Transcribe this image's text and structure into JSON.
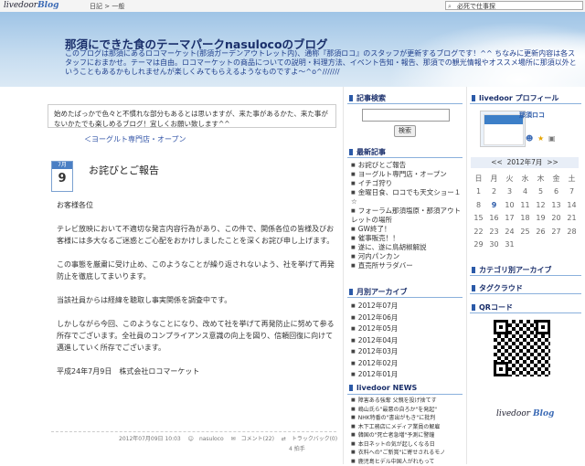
{
  "topbar": {
    "logo": "livedoor",
    "logo_blog": "Blog",
    "crumb": "日記 > 一般",
    "search_value": "必死で仕事探"
  },
  "header": {
    "title": "那須にできた食のテーマパークnasulocoのブログ",
    "description": "このブログは那須にあるロコマーケット(那須ガーデンアウトレット内)、通称『那須ロコ』のスタッフが更新するブログです！^^ ちなみに更新内容は各スタッフにおまかせ。テーマは自由。ロコマーケットの商品についての説明・料理方法、イベント告知・報告、那須での観光情報やオススメ場所に那須以外ということもあるかもしれませんが楽しくみてもらえるようなものですよ～^o^///////"
  },
  "intro": "始めたばっかで色々と不慣れな部分もあるとは思いますが、来た事があるかた、来た事がないかたでも楽しめるブログ！宜しくお願い致します^^",
  "prev_link": "＜ヨーグルト専門店・オープン",
  "post": {
    "month": "7月",
    "day": "9",
    "title": "お詫びとご報告",
    "paragraphs": [
      "お客様各位",
      "テレビ放映において不適切な発言内容行為があり、この件で、関係各位の皆様及びお客様には多大なるご迷惑とご心配をおかけしましたことを深くお詫び申し上げます。",
      "この事態を厳粛に受け止め、このようなことが繰り返されないよう、社を挙げて再発防止を徹底してまいります。",
      "当該社員からは経緯を聴取し事実関係を調査中です。",
      "しかしながら今回、このようなことになり、改めて社を挙げて再発防止に努めて参る所存でございます。全社員のコンプライアンス意識の向上を図り、信頼回復に向けて邁進していく所存でございます。",
      "平成24年7月9日　株式会社ロコマーケット"
    ],
    "meta_date": "2012年07月09日 10:03",
    "meta_author": "nasuloco",
    "meta_comments": "コメント(22)",
    "meta_trackback": "トラックバック(0)",
    "meta_count": "4 拍手"
  },
  "sidebar_mid": {
    "search_heading": "記事検索",
    "search_button": "検索",
    "recent_heading": "最新記事",
    "recent": [
      "お詫びとご報告",
      "ヨーグルト専門店・オープン",
      "イチゴ狩り",
      "金曜日食、ロコでも天文ショー１☆",
      "フォーラム那須塩原・那須アウトレットの場所",
      "GW終了！",
      "催事販売！！",
      "遂に、遂に鳥胡椒解説",
      "河内パンカン",
      "直売所サラダバー"
    ],
    "archive_heading": "月別アーカイブ",
    "archives": [
      "2012年07月",
      "2012年06月",
      "2012年05月",
      "2012年04月",
      "2012年03月",
      "2012年02月",
      "2012年01月"
    ],
    "news_heading": "livedoor NEWS",
    "news": [
      "障害ある強奪 父親を投げ捨てす",
      "嶋山氏ら\"最悪の自ろか\"を発起\"",
      "NHK特番の\"書出がもき\"に批判",
      "木下工務店にメディア業員の解雇",
      "韓国の\"死亡者急増\"予測に警鐘",
      "本日ネットの気が起しくなる日",
      "衣料への\"ご新賞\"に寄せされるモノ",
      "鹿児島ヒデル中国人がれもって"
    ]
  },
  "sidebar_right": {
    "profile_heading": "livedoor プロフィール",
    "profile_name": "那須ロコ",
    "calendar_prev": "<<",
    "calendar_title": "2012年7月",
    "calendar_next": ">>",
    "weekdays": [
      "日",
      "月",
      "火",
      "水",
      "木",
      "金",
      "土"
    ],
    "days": [
      [
        "1",
        "2",
        "3",
        "4",
        "5",
        "6",
        "7"
      ],
      [
        "8",
        "9",
        "10",
        "11",
        "12",
        "13",
        "14"
      ],
      [
        "15",
        "16",
        "17",
        "18",
        "19",
        "20",
        "21"
      ],
      [
        "22",
        "23",
        "24",
        "25",
        "26",
        "27",
        "28"
      ],
      [
        "29",
        "30",
        "31",
        "",
        "",
        "",
        ""
      ]
    ],
    "category_heading": "カテゴリ別アーカイブ",
    "tag_heading": "タグクラウド",
    "qr_heading": "QRコード",
    "footer_logo": "livedoor",
    "footer_logo_blog": "Blog"
  },
  "colors": {
    "accent": "#2b5aa8",
    "header_sky": "#9fc4e6"
  }
}
